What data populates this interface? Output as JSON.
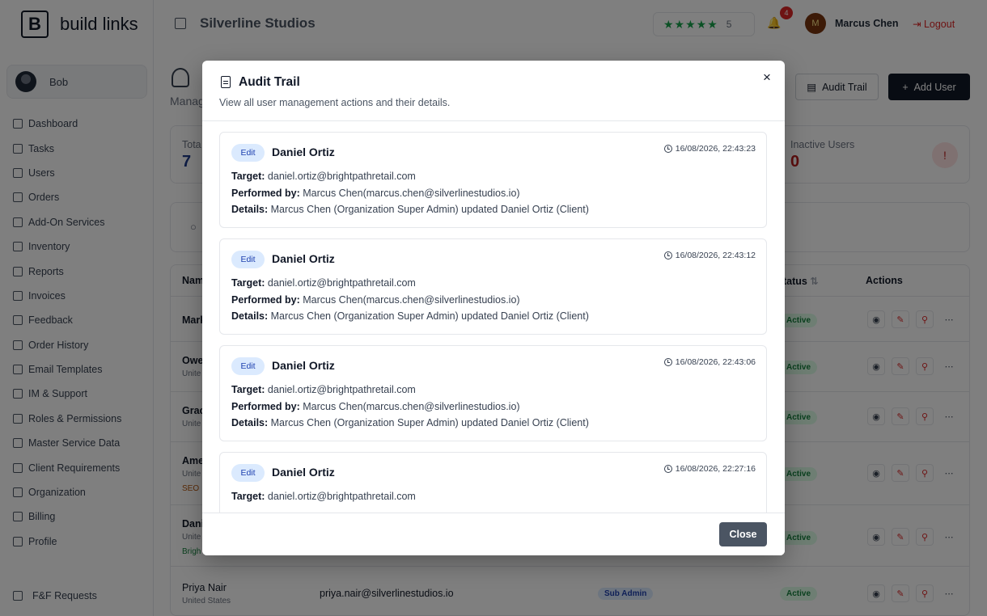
{
  "app": {
    "logo_letter": "B",
    "logo_text": "build links"
  },
  "sidebar": {
    "user_name": "Bob",
    "items": [
      {
        "label": "Dashboard",
        "icon": "dashboard-icon"
      },
      {
        "label": "Tasks",
        "icon": "tasks-icon"
      },
      {
        "label": "Users",
        "icon": "user-icon"
      },
      {
        "label": "Orders",
        "icon": "cart-icon"
      },
      {
        "label": "Add-On Services",
        "icon": "package-icon"
      },
      {
        "label": "Inventory",
        "icon": "inventory-icon"
      },
      {
        "label": "Reports",
        "icon": "chart-icon"
      },
      {
        "label": "Invoices",
        "icon": "invoice-icon"
      },
      {
        "label": "Feedback",
        "icon": "message-icon"
      },
      {
        "label": "Order History",
        "icon": "archive-icon"
      },
      {
        "label": "Email Templates",
        "icon": "mail-icon"
      },
      {
        "label": "IM & Support",
        "icon": "chat-icon"
      },
      {
        "label": "Roles & Permissions",
        "icon": "shield-icon"
      },
      {
        "label": "Master Service Data",
        "icon": "database-icon"
      },
      {
        "label": "Client Requirements",
        "icon": "clipboard-icon"
      },
      {
        "label": "Organization",
        "icon": "globe-icon"
      },
      {
        "label": "Billing",
        "icon": "card-icon"
      },
      {
        "label": "Profile",
        "icon": "user-icon"
      }
    ],
    "bottom_item": "F&F Requests"
  },
  "header": {
    "org_name": "Silverline Studios",
    "rating_value": "5",
    "rating_stars": 5,
    "notification_count": "4",
    "user_initial": "M",
    "user_name": "Marcus Chen",
    "logout_label": "Logout"
  },
  "page": {
    "subtitle_fragment": "Manag",
    "audit_button": "Audit Trail",
    "add_user_button": "Add User",
    "stats": [
      {
        "label": "Tota",
        "value": "7"
      },
      {
        "label": "Inactive Users",
        "value": "0"
      }
    ],
    "table": {
      "columns": [
        "Nam",
        "tatus",
        "Actions"
      ],
      "rows": [
        {
          "name": "Mark",
          "sub": "",
          "sub2": "",
          "email": "",
          "role": "",
          "status": "Active"
        },
        {
          "name": "Owe",
          "sub": "Unite",
          "sub2": "",
          "email": "",
          "role": "",
          "status": "Active"
        },
        {
          "name": "Grac",
          "sub": "Unite",
          "sub2": "",
          "email": "",
          "role": "",
          "status": "Active"
        },
        {
          "name": "Ame",
          "sub": "Unite",
          "sub2": "SEO",
          "email": "",
          "role": "",
          "status": "Active"
        },
        {
          "name": "Dani",
          "sub": "Unite",
          "sub2": "Brigh",
          "email": "",
          "role": "",
          "status": "Active"
        },
        {
          "name": "Priya Nair",
          "sub": "United States",
          "sub2": "",
          "email": "priya.nair@silverlinestudios.io",
          "role": "Sub Admin",
          "status": "Active"
        }
      ]
    }
  },
  "modal": {
    "title": "Audit Trail",
    "description": "View all user management actions and their details.",
    "close_button": "Close",
    "labels": {
      "target": "Target:",
      "performed_by": "Performed by:",
      "details": "Details:"
    },
    "entries": [
      {
        "action": "Edit",
        "name": "Daniel Ortiz",
        "timestamp": "16/08/2026, 22:43:23",
        "target": "daniel.ortiz@brightpathretail.com",
        "performed_by": "Marcus Chen(marcus.chen@silverlinestudios.io)",
        "details": "Marcus Chen (Organization Super Admin) updated Daniel Ortiz (Client)"
      },
      {
        "action": "Edit",
        "name": "Daniel Ortiz",
        "timestamp": "16/08/2026, 22:43:12",
        "target": "daniel.ortiz@brightpathretail.com",
        "performed_by": "Marcus Chen(marcus.chen@silverlinestudios.io)",
        "details": "Marcus Chen (Organization Super Admin) updated Daniel Ortiz (Client)"
      },
      {
        "action": "Edit",
        "name": "Daniel Ortiz",
        "timestamp": "16/08/2026, 22:43:06",
        "target": "daniel.ortiz@brightpathretail.com",
        "performed_by": "Marcus Chen(marcus.chen@silverlinestudios.io)",
        "details": "Marcus Chen (Organization Super Admin) updated Daniel Ortiz (Client)"
      },
      {
        "action": "Edit",
        "name": "Daniel Ortiz",
        "timestamp": "16/08/2026, 22:27:16",
        "target": "daniel.ortiz@brightpathretail.com",
        "performed_by": "",
        "details": ""
      }
    ]
  },
  "colors": {
    "accent": "#111827",
    "badge_bg": "#dbeafe",
    "badge_text": "#1e40af",
    "danger": "#dc2626",
    "success": "#16a34a"
  }
}
